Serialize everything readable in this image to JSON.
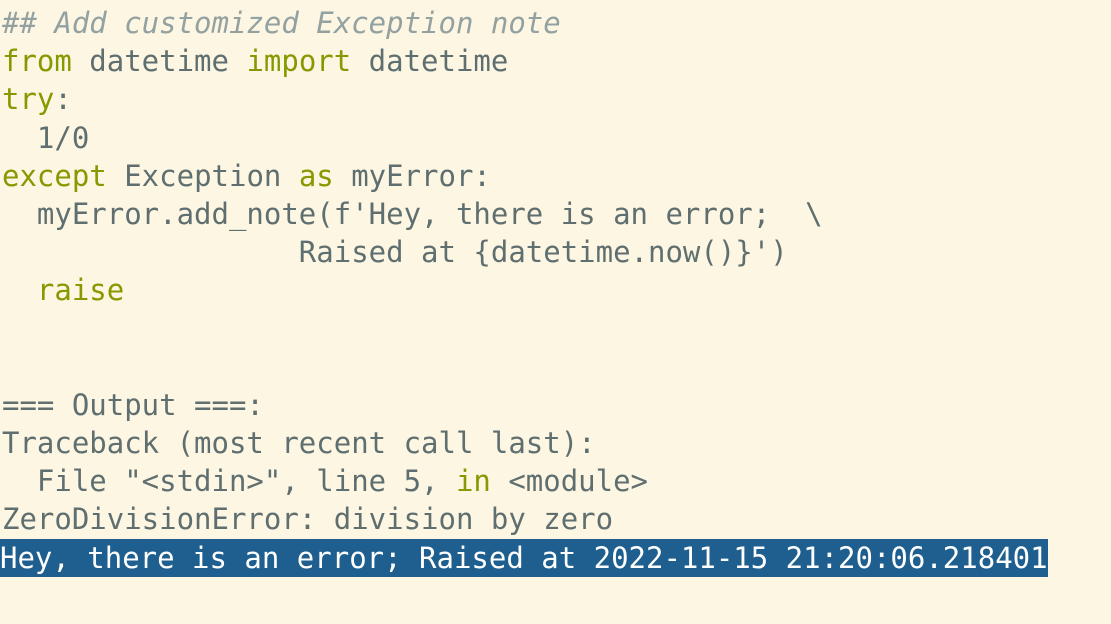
{
  "code": {
    "l1_comment": "## Add customized Exception note",
    "l2_kw1": "from",
    "l2_p1": " datetime ",
    "l2_kw2": "import",
    "l2_p2": " datetime",
    "l3_kw": "try",
    "l3_p": ":",
    "l4": "  1/0",
    "l5_kw1": "except",
    "l5_p1": " Exception ",
    "l5_kw2": "as",
    "l5_p2": " myError:",
    "l6": "  myError.add_note(f'Hey, there is an error;  \\",
    "l7": "                 Raised at {datetime.now()}')",
    "l8_indent": "  ",
    "l8_kw": "raise"
  },
  "output": {
    "header": "=== Output ===:",
    "traceback": "Traceback (most recent call last):",
    "file_p1": "  File \"<stdin>\", line 5, ",
    "file_kw": "in",
    "file_p2": " <module>",
    "error": "ZeroDivisionError: division by zero",
    "note": "Hey, there is an error; Raised at 2022-11-15 21:20:06.218401"
  },
  "colors": {
    "background": "#fdf6e3",
    "keyword": "#859900",
    "comment": "#93a1a1",
    "text": "#5f6f70",
    "selection": "#1e5f8f"
  }
}
